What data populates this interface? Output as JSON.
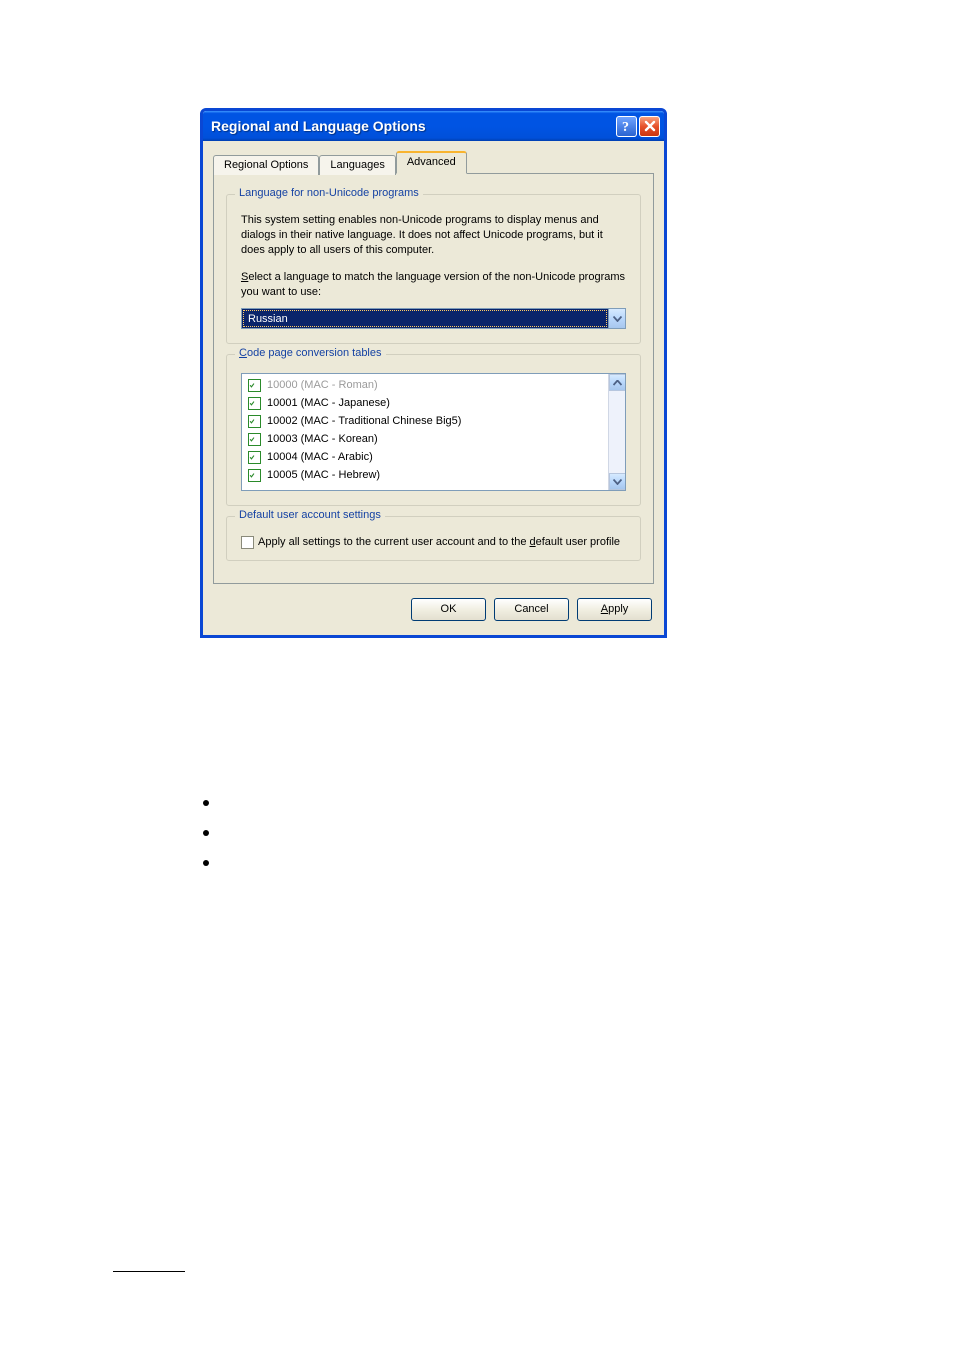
{
  "titlebar": {
    "title": "Regional and Language Options"
  },
  "tabs": [
    "Regional Options",
    "Languages",
    "Advanced"
  ],
  "activeTab": 2,
  "lang_group": {
    "legend_pre": "L",
    "legend_u": "a",
    "legend_post": "nguage for non-Unicode programs",
    "desc": "This system setting enables non-Unicode programs to display menus and dialogs in their native language. It does not affect Unicode programs, but it does apply to all users of this computer.",
    "select_pre": "",
    "select_u": "S",
    "select_post": "elect a language to match the language version of the non-Unicode programs you want to use:",
    "selected": "Russian"
  },
  "code_group": {
    "legend_u": "C",
    "legend_post": "ode page conversion tables",
    "items": [
      {
        "label": "10000 (MAC - Roman)",
        "checked": true,
        "disabled": true
      },
      {
        "label": "10001 (MAC - Japanese)",
        "checked": true,
        "disabled": false
      },
      {
        "label": "10002 (MAC - Traditional Chinese Big5)",
        "checked": true,
        "disabled": false
      },
      {
        "label": "10003 (MAC - Korean)",
        "checked": true,
        "disabled": false
      },
      {
        "label": "10004 (MAC - Arabic)",
        "checked": true,
        "disabled": false
      },
      {
        "label": "10005 (MAC - Hebrew)",
        "checked": true,
        "disabled": false
      }
    ]
  },
  "default_group": {
    "legend": "Default user account settings",
    "check_pre": "Apply all settings to the current user account and to the ",
    "check_u": "d",
    "check_post": "efault user profile"
  },
  "buttons": {
    "ok": "OK",
    "cancel": "Cancel",
    "apply_u": "A",
    "apply_post": "pply"
  }
}
